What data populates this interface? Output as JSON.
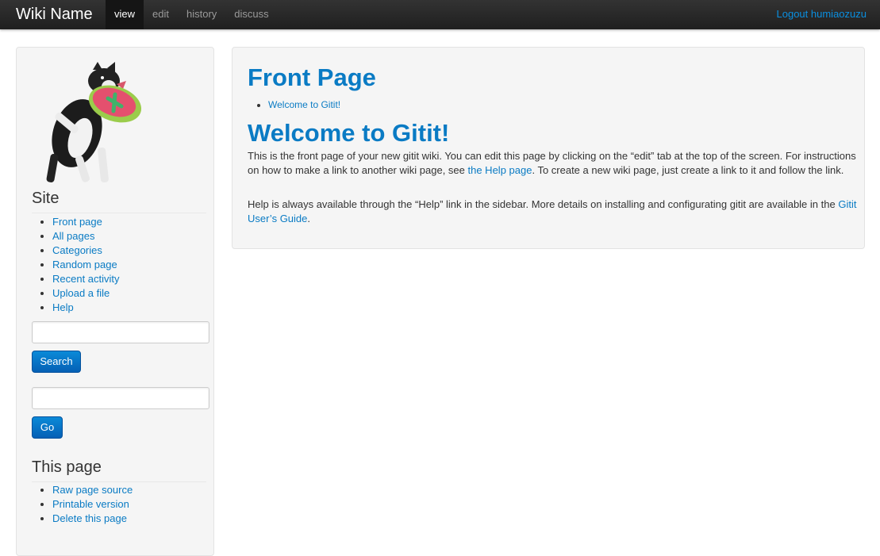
{
  "topbar": {
    "brand": "Wiki Name",
    "tabs": [
      {
        "label": "view"
      },
      {
        "label": "edit"
      },
      {
        "label": "history"
      },
      {
        "label": "discuss"
      }
    ],
    "logout": "Logout humiaozuzu"
  },
  "sidebar": {
    "logo_icon": "dog-catching-frisbee-logo",
    "site_heading": "Site",
    "site_links": [
      {
        "label": "Front page"
      },
      {
        "label": "All pages"
      },
      {
        "label": "Categories"
      },
      {
        "label": "Random page"
      },
      {
        "label": "Recent activity"
      },
      {
        "label": "Upload a file"
      },
      {
        "label": "Help"
      }
    ],
    "search_value": "",
    "search_button": "Search",
    "go_value": "",
    "go_button": "Go",
    "this_page_heading": "This page",
    "page_links": [
      {
        "label": "Raw page source"
      },
      {
        "label": "Printable version"
      },
      {
        "label": "Delete this page"
      }
    ]
  },
  "main": {
    "title": "Front Page",
    "toc": [
      {
        "label": "Welcome to Gitit!"
      }
    ],
    "section_title": "Welcome to Gitit!",
    "p1": {
      "before": "This is the front page of your new gitit wiki. You can edit this page by clicking on the “edit” tab at the top of the screen. For instructions on how to make a link to another wiki page, see ",
      "link": "the Help page",
      "after": ". To create a new wiki page, just create a link to it and follow the link."
    },
    "p2": {
      "before": "Help is always available through the “Help” link in the sidebar. More details on installing and configurating gitit are available in the ",
      "link": "Gitit User’s Guide",
      "after": "."
    }
  },
  "colors": {
    "link": "#0a7bc4",
    "topbar": "#222222",
    "button": "#0a7bc4"
  }
}
